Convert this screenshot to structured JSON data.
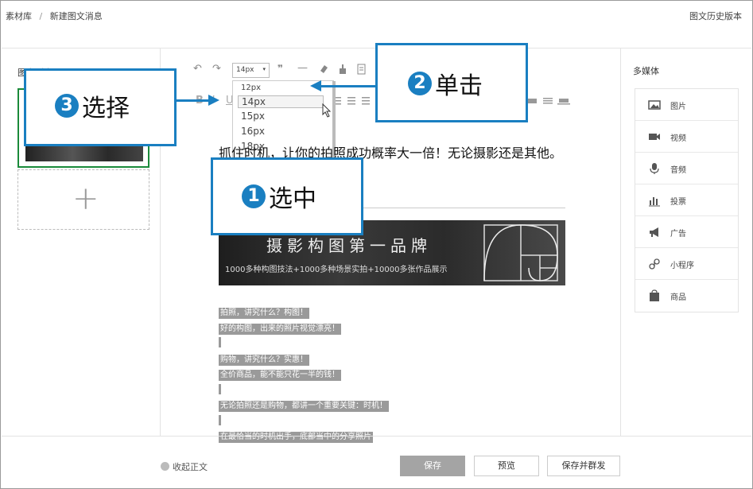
{
  "breadcrumb": {
    "root": "素材库",
    "separator": "/",
    "current": "新建图文消息"
  },
  "history_label": "图文历史版本",
  "left_panel": {
    "title": "图文列表",
    "add_symbol": "+"
  },
  "toolbar": {
    "undo": "↶",
    "redo": "↷",
    "font_size_value": "14px",
    "font_size_arrow": "▾",
    "quote": "❞",
    "hr": "—",
    "bold": "B",
    "italic": "I",
    "underline": "U"
  },
  "font_size_options": [
    "12px",
    "14px",
    "15px",
    "16px",
    "18px"
  ],
  "editor": {
    "headline": "抓住时机，让你的拍照成功概率大一倍！无论摄影还是其他。",
    "banner_title": "摄影构图第一品牌",
    "banner_subtitle": "1000多种构图技法+1000多种场景实拍+10000多张作品展示",
    "lines": [
      "拍照，讲究什么？构图！",
      "好的构图，出来的照片视觉漂亮！",
      "|",
      "购物，讲究什么？实惠！",
      "全价商品，能不能只花一半的钱！",
      "|",
      "无论拍照还是购物，都讲一个重要关键：时机！",
      "|",
      "在最恰当的时机出手，底部当中的分享照片"
    ]
  },
  "right_panel": {
    "title": "多媒体",
    "items": [
      {
        "label": "图片",
        "icon": "image-icon"
      },
      {
        "label": "视频",
        "icon": "video-icon"
      },
      {
        "label": "音频",
        "icon": "microphone-icon"
      },
      {
        "label": "投票",
        "icon": "bar-chart-icon"
      },
      {
        "label": "广告",
        "icon": "megaphone-icon"
      },
      {
        "label": "小程序",
        "icon": "mini-program-icon"
      },
      {
        "label": "商品",
        "icon": "shopping-bag-icon"
      }
    ]
  },
  "footer": {
    "collapse_label": "收起正文",
    "save": "保存",
    "preview": "预览",
    "save_publish": "保存并群发"
  },
  "annotations": {
    "step1": {
      "number": "1",
      "text": "选中"
    },
    "step2": {
      "number": "2",
      "text": "单击"
    },
    "step3": {
      "number": "3",
      "text": "选择"
    }
  },
  "colors": {
    "callout_blue": "#1a7fc1",
    "selection_gray": "#9a9a9a",
    "primary_button": "#a4a4a4"
  }
}
